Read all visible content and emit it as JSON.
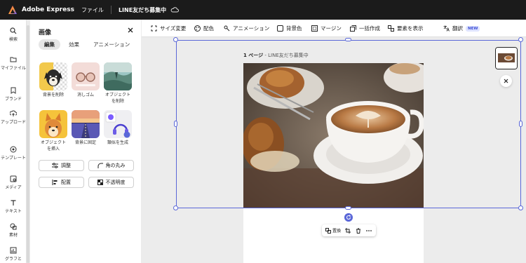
{
  "topbar": {
    "app_name": "Adobe Express",
    "file_menu": "ファイル",
    "doc_title": "LINE友だち募集中"
  },
  "rail": {
    "items": [
      {
        "label": "検索",
        "icon": "search-icon"
      },
      {
        "label": "マイファイル",
        "icon": "folder-icon"
      },
      {
        "label": "ブランド",
        "icon": "brand-icon"
      },
      {
        "label": "アップロード",
        "icon": "upload-icon"
      },
      {
        "label": "テンプレート",
        "icon": "template-icon"
      },
      {
        "label": "メディア",
        "icon": "media-icon"
      },
      {
        "label": "テキスト",
        "icon": "text-icon"
      },
      {
        "label": "素材",
        "icon": "elements-icon"
      },
      {
        "label": "グラフと",
        "icon": "chart-icon"
      }
    ]
  },
  "panel": {
    "title": "画像",
    "tabs": [
      "編集",
      "効果",
      "アニメーション"
    ],
    "tools": [
      {
        "label": "背景を削除"
      },
      {
        "label": "消しゴム"
      },
      {
        "label": "オブジェクト\nを削除"
      },
      {
        "label": "オブジェクト\nを挿入"
      },
      {
        "label": "背景に固定"
      },
      {
        "label": "類似を生成"
      }
    ],
    "buttons": [
      "調整",
      "角の丸み",
      "配置",
      "不透明度"
    ]
  },
  "toolbar": {
    "items": [
      "サイズ変更",
      "配色",
      "アニメーション",
      "背景色",
      "マージン",
      "一括作成",
      "要素を表示",
      "翻訳"
    ],
    "new_badge": "NEW"
  },
  "canvas": {
    "page_number": "1 ページ",
    "page_title": " - LINE友だち募集中",
    "context_replace": "置換",
    "accent_color": "#5a67d8"
  }
}
